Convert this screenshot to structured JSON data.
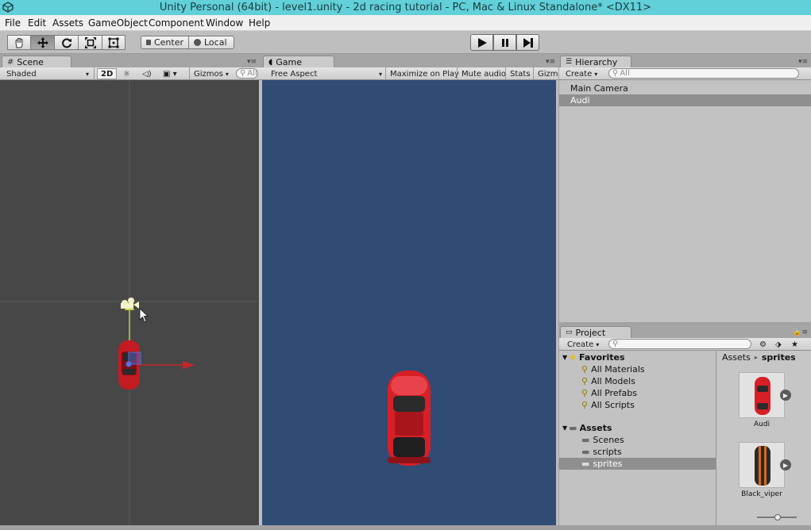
{
  "window": {
    "title": "Unity Personal (64bit) - level1.unity - 2d racing tutorial - PC, Mac & Linux Standalone* <DX11>"
  },
  "menu": [
    "File",
    "Edit",
    "Assets",
    "GameObject",
    "Component",
    "Window",
    "Help"
  ],
  "toolbar": {
    "tools": [
      "hand-tool",
      "move-tool",
      "rotate-tool",
      "scale-tool",
      "rect-tool"
    ],
    "selected_tool": "move-tool",
    "pivot_label": "Center",
    "space_label": "Local",
    "playback": [
      "play",
      "pause",
      "step"
    ]
  },
  "scene": {
    "tab_label": "Scene",
    "shading": "Shaded",
    "mode_2d": "2D",
    "gizmos": "Gizmos",
    "search_placeholder": "All"
  },
  "game": {
    "tab_label": "Game",
    "aspect": "Free Aspect",
    "maximize": "Maximize on Play",
    "mute": "Mute audio",
    "stats": "Stats",
    "gizmos": "Gizm",
    "background_color": "#304b74"
  },
  "hierarchy": {
    "tab_label": "Hierarchy",
    "create": "Create",
    "search_placeholder": "All",
    "items": [
      {
        "label": "Main Camera",
        "selected": false
      },
      {
        "label": "Audi",
        "selected": true
      }
    ]
  },
  "project": {
    "tab_label": "Project",
    "create": "Create",
    "favorites_label": "Favorites",
    "favorites": [
      "All Materials",
      "All Models",
      "All Prefabs",
      "All Scripts"
    ],
    "assets_label": "Assets",
    "folders": [
      {
        "label": "Scenes",
        "selected": false
      },
      {
        "label": "scripts",
        "selected": false
      },
      {
        "label": "sprites",
        "selected": true
      }
    ],
    "breadcrumb_root": "Assets",
    "breadcrumb_leaf": "sprites",
    "assets": [
      "Audi",
      "Black_viper"
    ]
  },
  "colors": {
    "titlebar": "#62d0d8",
    "selection": "#8f8f8f",
    "car_red": "#d81f26"
  }
}
